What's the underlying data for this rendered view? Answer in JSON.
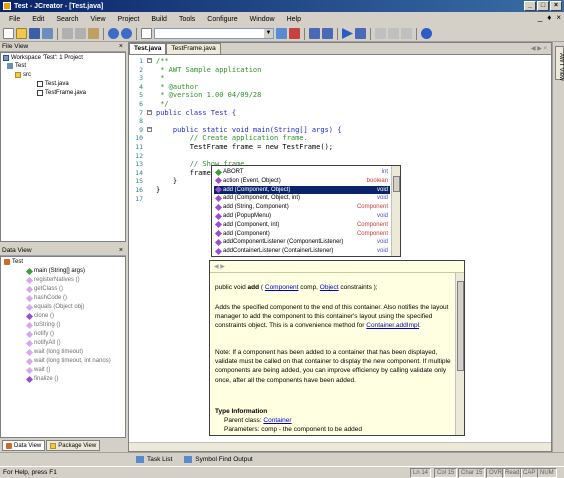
{
  "window": {
    "title": "Test - JCreator - [Test.java]"
  },
  "menu": [
    "File",
    "Edit",
    "Search",
    "View",
    "Project",
    "Build",
    "Tools",
    "Configure",
    "Window",
    "Help"
  ],
  "file_view": {
    "header": "File View",
    "items": [
      "Workspace 'Test': 1 Project",
      "Test",
      "src",
      "Test.java",
      "TestFrame.java"
    ]
  },
  "data_view": {
    "header": "Data View",
    "root": "Test",
    "items": [
      "main (String[] args)",
      "registerNatives ()",
      "getClass ()",
      "hashCode ()",
      "equals (Object obj)",
      "clone ()",
      "toString ()",
      "notify ()",
      "notifyAll ()",
      "wait (long timeout)",
      "wait (long timeout, int nanos)",
      "wait ()",
      "finalize ()"
    ],
    "tabs": [
      "Data View",
      "Package View"
    ]
  },
  "editor": {
    "tabs": [
      "Test.java",
      "TestFrame.java"
    ],
    "lines": [
      {
        "n": "1",
        "t": "/**",
        "k": "cm"
      },
      {
        "n": "2",
        "t": " * AWT Sample application",
        "k": "cm"
      },
      {
        "n": "3",
        "t": " *",
        "k": "cm"
      },
      {
        "n": "4",
        "t": " * @author",
        "k": "cm"
      },
      {
        "n": "5",
        "t": " * @version 1.00 04/09/28",
        "k": "cm"
      },
      {
        "n": "6",
        "t": " */",
        "k": "cm"
      },
      {
        "n": "7",
        "t": "public class Test {",
        "k": "kw"
      },
      {
        "n": "8",
        "t": "",
        "k": "pl"
      },
      {
        "n": "9",
        "t": "    public static void main(String[] args) {",
        "k": "kw"
      },
      {
        "n": "10",
        "t": "        // Create application frame.",
        "k": "cm"
      },
      {
        "n": "11",
        "t": "        TestFrame frame = new TestFrame();",
        "k": "pl"
      },
      {
        "n": "12",
        "t": "",
        "k": "pl"
      },
      {
        "n": "13",
        "t": "        // Show frame",
        "k": "cm"
      },
      {
        "n": "14",
        "t": "        frame.setVisible(true);",
        "k": "pl"
      },
      {
        "n": "15",
        "t": "    }",
        "k": "pl"
      },
      {
        "n": "16",
        "t": "}",
        "k": "pl"
      },
      {
        "n": "17",
        "t": "",
        "k": "pl"
      }
    ]
  },
  "completion": {
    "items": [
      {
        "label": "ABORT",
        "type": "int"
      },
      {
        "label": "action (Event, Object)",
        "type": "boolean"
      },
      {
        "label": "add (Component, Object)",
        "type": "void"
      },
      {
        "label": "add (Component, Object, int)",
        "type": "void"
      },
      {
        "label": "add (String, Component)",
        "type": "Component"
      },
      {
        "label": "add (PopupMenu)",
        "type": "void"
      },
      {
        "label": "add (Component, int)",
        "type": "Component"
      },
      {
        "label": "add (Component)",
        "type": "Component"
      },
      {
        "label": "addComponentListener (ComponentListener)",
        "type": "void"
      },
      {
        "label": "addContainerListener (ContainerListener)",
        "type": "void"
      }
    ],
    "selected_index": 2
  },
  "javadoc": {
    "sig_pre": "public void ",
    "sig_name": "add",
    "sig_p1": "Component",
    "sig_mid": " comp, ",
    "sig_p2": "Object",
    "sig_end": " constraints );",
    "p1": "Adds the specified component to the end of this container. Also notifies the layout manager to add the component to this container's layout using the specified constraints object. This is a convenience method for",
    "p1_link": "Container.addImpl",
    "p2": "Note: If a component has been added to a container that has been displayed, validate must be called on that container to display the new component. If multiple components are being added, you can improve efficiency by calling validate only once, after all the components have been added.",
    "type_heading": "Type Information",
    "parent_label": "Parent class: ",
    "parent_link": "Container",
    "params": "Parameters:   comp - the component to be added"
  },
  "right_strip": {
    "tab": "AWT View"
  },
  "bottom_tabs": [
    "Task List",
    "Symbol Find Output"
  ],
  "status": {
    "help": "For Help, press F1",
    "ln": "Ln 14",
    "col": "Col 15",
    "char": "Char 15",
    "ovr": "OVR",
    "read": "Read",
    "cap": "CAP",
    "num": "NUM"
  }
}
